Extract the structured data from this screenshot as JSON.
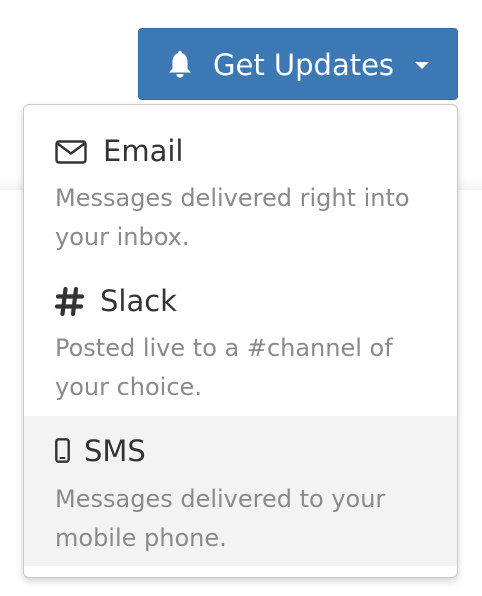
{
  "header": {
    "button_label": "Get Updates",
    "button_icon": "bell-icon",
    "caret_icon": "caret-down-icon"
  },
  "colors": {
    "button_bg": "#3c79b4",
    "dropdown_bg": "#ffffff",
    "highlight_bg": "#f3f3f3",
    "title_text": "#333333",
    "desc_text": "#8a8a8a"
  },
  "dropdown": {
    "items": [
      {
        "icon": "envelope-icon",
        "title": "Email",
        "description": "Messages delivered right into your inbox."
      },
      {
        "icon": "hashtag-icon",
        "title": "Slack",
        "description": "Posted live to a #channel of your choice."
      },
      {
        "icon": "mobile-phone-icon",
        "title": "SMS",
        "description": "Messages delivered to your mobile phone.",
        "highlighted": true
      }
    ]
  }
}
